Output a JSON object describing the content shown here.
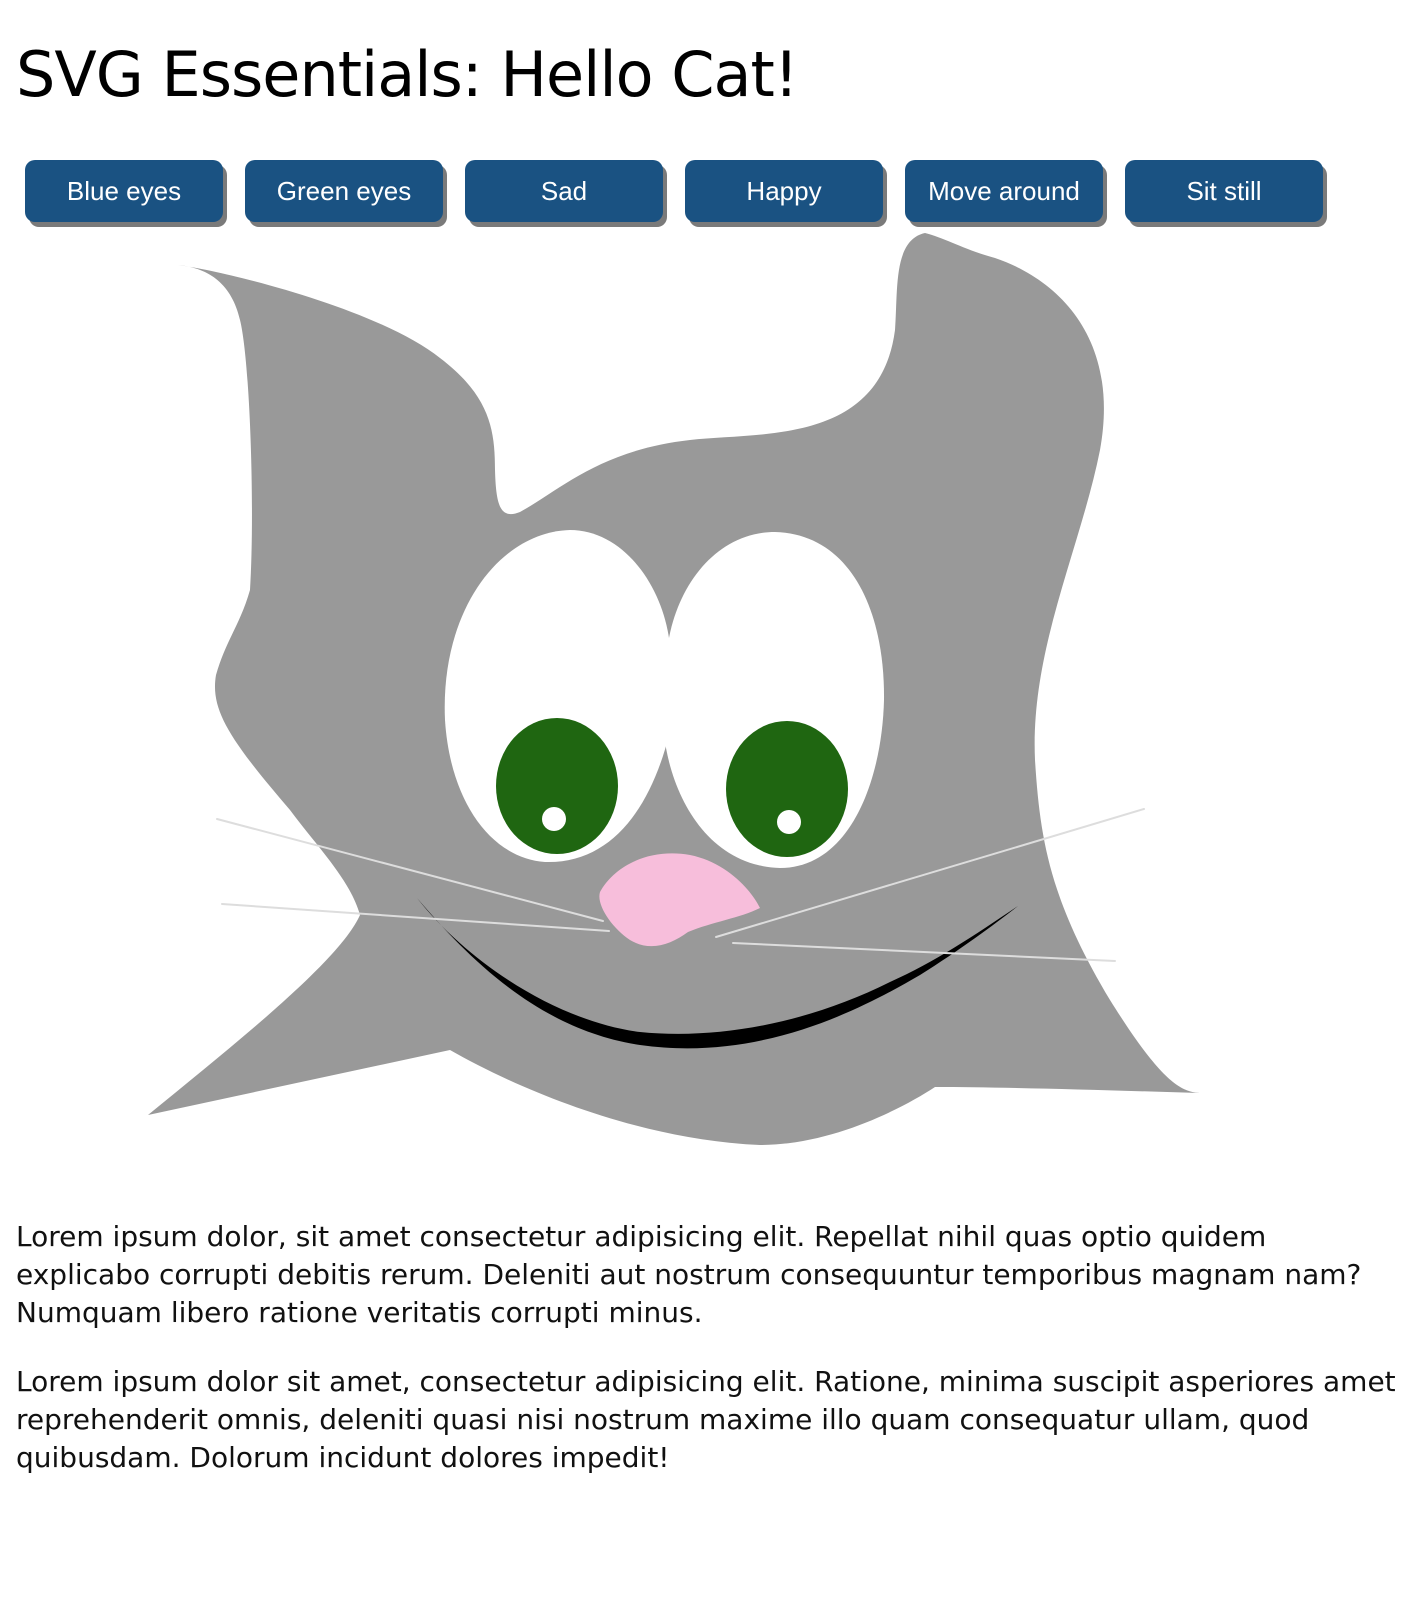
{
  "page": {
    "title": "SVG Essentials: Hello Cat!"
  },
  "controls": [
    {
      "id": "blue-eyes",
      "label": "Blue eyes"
    },
    {
      "id": "green-eyes",
      "label": "Green eyes"
    },
    {
      "id": "sad",
      "label": "Sad"
    },
    {
      "id": "happy",
      "label": "Happy"
    },
    {
      "id": "move-around",
      "label": "Move around"
    },
    {
      "id": "sit-still",
      "label": "Sit still"
    }
  ],
  "cat": {
    "body_color": "#999999",
    "eye_white_color": "#ffffff",
    "iris_color": "#1f6611",
    "nose_color": "#f7bedb",
    "mouth_color": "#000000",
    "whisker_color": "#dddddd",
    "expression": "happy",
    "eye_color_name": "green"
  },
  "paragraphs": [
    "Lorem ipsum dolor, sit amet consectetur adipisicing elit. Repellat nihil quas optio quidem explicabo corrupti debitis rerum. Deleniti aut nostrum consequuntur temporibus magnam nam? Numquam libero ratione veritatis corrupti minus.",
    "Lorem ipsum dolor sit amet, consectetur adipisicing elit. Ratione, minima suscipit asperiores amet reprehenderit omnis, deleniti quasi nisi nostrum maxime illo quam consequatur ullam, quod quibusdam. Dolorum incidunt dolores impedit!"
  ],
  "theme": {
    "button_bg": "#1a5282",
    "button_text": "#ffffff",
    "button_shadow": "#7a7a7a"
  }
}
